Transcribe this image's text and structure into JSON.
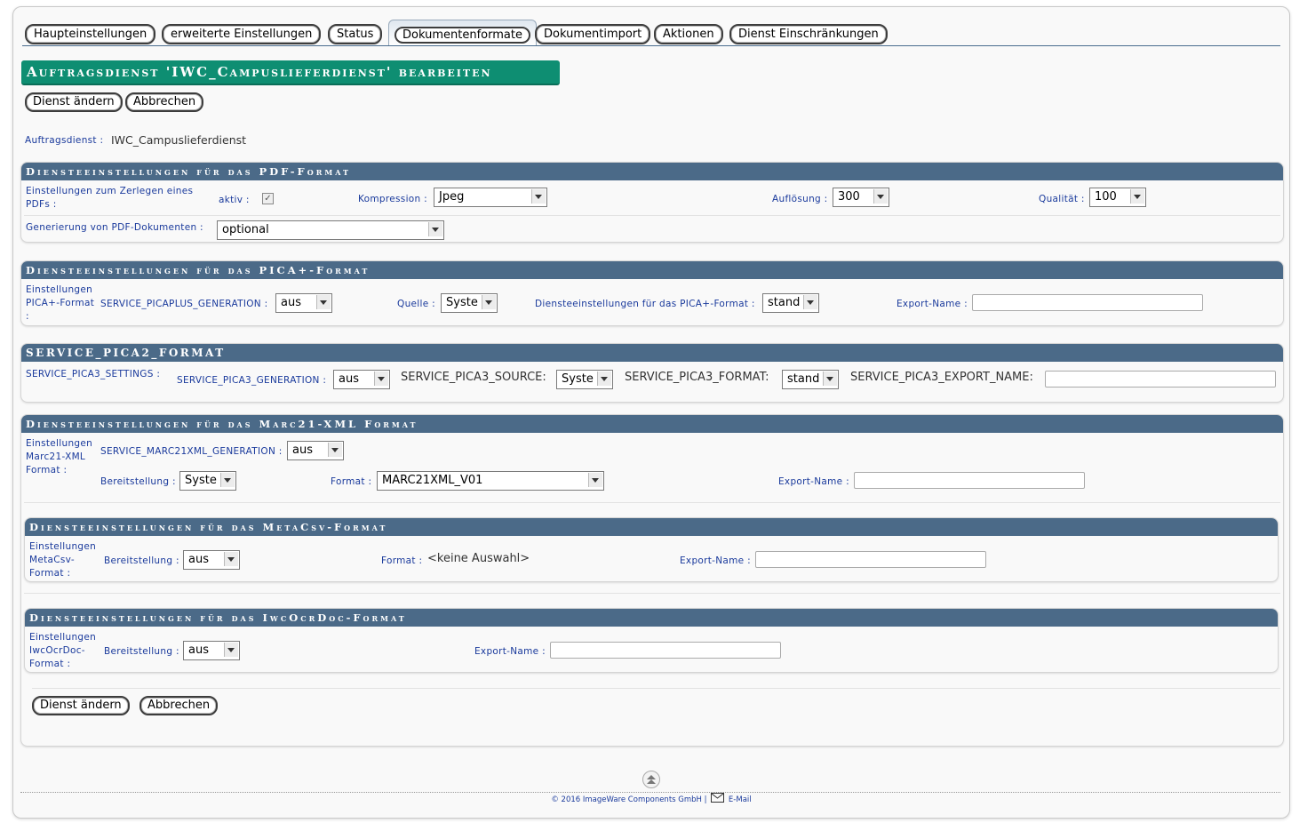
{
  "tabs": [
    "Haupteinstellungen",
    "erweiterte Einstellungen",
    "Status",
    "Dokumentenformate",
    "Dokumentimport",
    "Aktionen",
    "Dienst Einschränkungen"
  ],
  "title": "Auftragsdienst 'IWC_Campuslieferdienst' bearbeiten",
  "buttons": {
    "change": "Dienst ändern",
    "cancel": "Abbrechen"
  },
  "service": {
    "label": "Auftragsdienst :",
    "value": "IWC_Campuslieferdienst"
  },
  "pdf": {
    "header": "Diensteeinstellungen für das PDF-Format",
    "split_label": "Einstellungen zum Zerlegen eines PDFs :",
    "active_label": "aktiv :",
    "active_checked": true,
    "compression_label": "Kompression :",
    "compression": "Jpeg",
    "resolution_label": "Auflösung :",
    "resolution": "300",
    "quality_label": "Qualität :",
    "quality": "100",
    "generation_label": "Generierung von PDF-Dokumenten :",
    "generation": "optional"
  },
  "pica": {
    "header": "Diensteeinstellungen für das PICA+-Format",
    "settings_label": "Einstellungen PICA+-Format :",
    "generation_label": "SERVICE_PICAPLUS_GENERATION :",
    "generation": "aus",
    "source_label": "Quelle :",
    "source": "Syste",
    "format_label": "Diensteeinstellungen für das PICA+-Format :",
    "format": "stand",
    "export_label": "Export-Name :",
    "export": ""
  },
  "pica3": {
    "header": "SERVICE_PICA2_FORMAT",
    "settings_label": "SERVICE_PICA3_SETTINGS :",
    "generation_label": "SERVICE_PICA3_GENERATION :",
    "generation": "aus",
    "source_label": "SERVICE_PICA3_SOURCE:",
    "source": "Syste",
    "format_label": "SERVICE_PICA3_FORMAT:",
    "format": "stand",
    "export_label": "SERVICE_PICA3_EXPORT_NAME:",
    "export": ""
  },
  "marc": {
    "header": "Diensteeinstellungen für das Marc21-XML Format",
    "settings_label": "Einstellungen Marc21-XML Format :",
    "generation_label": "SERVICE_MARC21XML_GENERATION :",
    "generation": "aus",
    "provision_label": "Bereitstellung :",
    "provision": "Syste",
    "format_label": "Format :",
    "format": "MARC21XML_V01",
    "export_label": "Export-Name :",
    "export": ""
  },
  "metacsv": {
    "header": "Diensteeinstellungen für das MetaCsv-Format",
    "settings_label": "Einstellungen MetaCsv-Format :",
    "provision_label": "Bereitstellung :",
    "provision": "aus",
    "format_label": "Format :",
    "format": "<keine Auswahl>",
    "export_label": "Export-Name :",
    "export": ""
  },
  "ocr": {
    "header": "Diensteeinstellungen für das IwcOcrDoc-Format",
    "settings_label": "Einstellungen IwcOcrDoc-Format :",
    "provision_label": "Bereitstellung :",
    "provision": "aus",
    "export_label": "Export-Name :",
    "export": ""
  },
  "footer": {
    "copyright": "© 2016 ImageWare Components GmbH |",
    "email": "E-Mail"
  }
}
